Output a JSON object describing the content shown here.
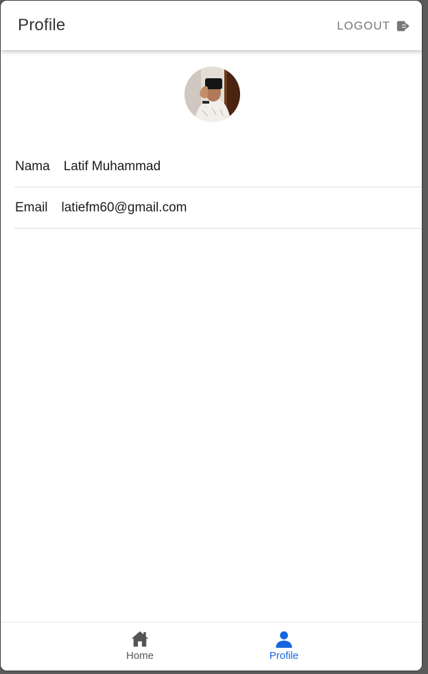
{
  "header": {
    "title": "Profile",
    "logout_label": "LOGOUT",
    "logout_icon": "logout-icon"
  },
  "profile": {
    "avatar": "profile-photo",
    "fields": [
      {
        "label": "Nama",
        "value": "Latif Muhammad"
      },
      {
        "label": "Email",
        "value": "latiefm60@gmail.com"
      }
    ]
  },
  "bottom_nav": {
    "items": [
      {
        "label": "Home",
        "icon": "home-icon",
        "active": false
      },
      {
        "label": "Profile",
        "icon": "person-icon",
        "active": true
      }
    ]
  },
  "colors": {
    "active": "#1565e0",
    "inactive": "#555555",
    "muted": "#777777"
  }
}
